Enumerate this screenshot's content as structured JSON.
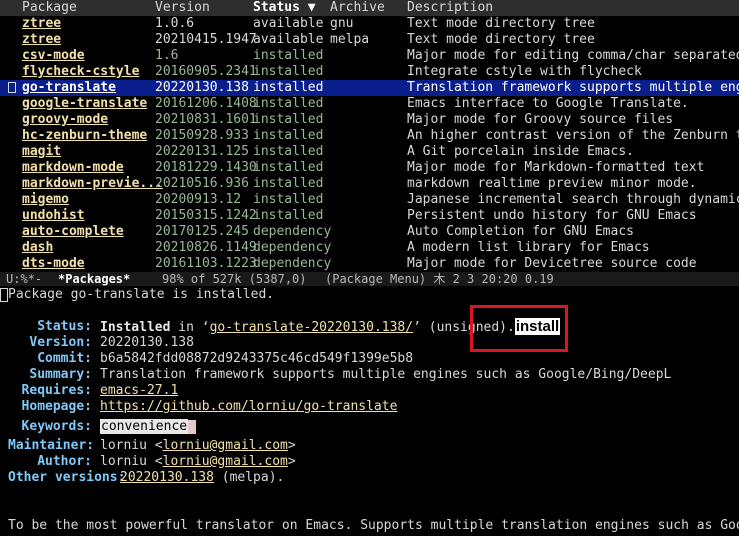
{
  "header": {
    "col_package": "Package",
    "col_version": "Version",
    "col_status": "Status ▼",
    "col_archive": "Archive",
    "col_description": "Description"
  },
  "packages": [
    {
      "name": "ztree",
      "version": "1.0.6",
      "status": "available",
      "archive": "gnu",
      "description": "Text mode directory tree",
      "kind": "avail"
    },
    {
      "name": "ztree",
      "version": "20210415.1947",
      "status": "available",
      "archive": "melpa",
      "description": "Text mode directory tree",
      "kind": "avail"
    },
    {
      "name": "csv-mode",
      "version": "1.6",
      "status": "installed",
      "archive": "",
      "description": "Major mode for editing comma/char separated va",
      "kind": "inst"
    },
    {
      "name": "flycheck-cstyle",
      "version": "20160905.2341",
      "status": "installed",
      "archive": "",
      "description": "Integrate cstyle with flycheck",
      "kind": "inst"
    },
    {
      "name": "go-translate",
      "version": "20220130.138",
      "status": "installed",
      "archive": "",
      "description": "Translation framework supports multiple engine",
      "kind": "inst",
      "selected": true
    },
    {
      "name": "google-translate",
      "version": "20161206.1408",
      "status": "installed",
      "archive": "",
      "description": "Emacs interface to Google Translate.",
      "kind": "inst"
    },
    {
      "name": "groovy-mode",
      "version": "20210831.1601",
      "status": "installed",
      "archive": "",
      "description": "Major mode for Groovy source files",
      "kind": "inst"
    },
    {
      "name": "hc-zenburn-theme",
      "version": "20150928.933",
      "status": "installed",
      "archive": "",
      "description": "An higher contrast version of the Zenburn them",
      "kind": "inst"
    },
    {
      "name": "magit",
      "version": "20220131.125",
      "status": "installed",
      "archive": "",
      "description": "A Git porcelain inside Emacs.",
      "kind": "inst"
    },
    {
      "name": "markdown-mode",
      "version": "20181229.1430",
      "status": "installed",
      "archive": "",
      "description": "Major mode for Markdown-formatted text",
      "kind": "inst"
    },
    {
      "name": "markdown-previe...",
      "version": "20210516.936",
      "status": "installed",
      "archive": "",
      "description": "markdown realtime preview minor mode.",
      "kind": "inst"
    },
    {
      "name": "migemo",
      "version": "20200913.12",
      "status": "installed",
      "archive": "",
      "description": "Japanese incremental search through dynamic pa",
      "kind": "inst"
    },
    {
      "name": "undohist",
      "version": "20150315.1242",
      "status": "installed",
      "archive": "",
      "description": "Persistent undo history for GNU Emacs",
      "kind": "inst"
    },
    {
      "name": "auto-complete",
      "version": "20170125.245",
      "status": "dependency",
      "archive": "",
      "description": "Auto Completion for GNU Emacs",
      "kind": "dep"
    },
    {
      "name": "dash",
      "version": "20210826.1149",
      "status": "dependency",
      "archive": "",
      "description": "A modern list library for Emacs",
      "kind": "dep"
    },
    {
      "name": "dts-mode",
      "version": "20161103.1223",
      "status": "dependency",
      "archive": "",
      "description": "Major mode for Devicetree source code",
      "kind": "dep"
    }
  ],
  "modeline": {
    "state": "U:%*-",
    "buffer": "*Packages*",
    "position": "98% of 527k (5387,0)",
    "mode": "(Package Menu) 木 2  3 20:20 0.19"
  },
  "help": {
    "intro": "Package go-translate is installed.",
    "status_label": "Status:",
    "status_installed": "Installed",
    "status_in": " in  ‘",
    "status_dir": "go-translate-20220130.138/",
    "status_after": "’  (unsigned).",
    "install_button": "install",
    "version_label": "Version:",
    "version_value": "20220130.138",
    "commit_label": "Commit:",
    "commit_value": "b6a5842fdd08872d9243375c46cd549f1399e5b8",
    "summary_label": "Summary:",
    "summary_value": "Translation framework supports multiple engines such as Google/Bing/DeepL",
    "requires_label": "Requires:",
    "requires_value": "emacs-27.1",
    "homepage_label": "Homepage:",
    "homepage_value": "https://github.com/lorniu/go-translate",
    "keywords_label": "Keywords:",
    "keywords_value": "convenience",
    "maintainer_label": "Maintainer:",
    "maintainer_name": "lorniu <",
    "maintainer_email": "lorniu@gmail.com",
    "maintainer_close": ">",
    "author_label": "Author:",
    "author_name": "lorniu <",
    "author_email": "lorniu@gmail.com",
    "author_close": ">",
    "other_label": "Other versions:",
    "other_version": "20220130.138",
    "other_archive": " (melpa).",
    "description": "To be the most powerful translator on Emacs. Supports multiple translation engines such as Google, Bing,"
  }
}
